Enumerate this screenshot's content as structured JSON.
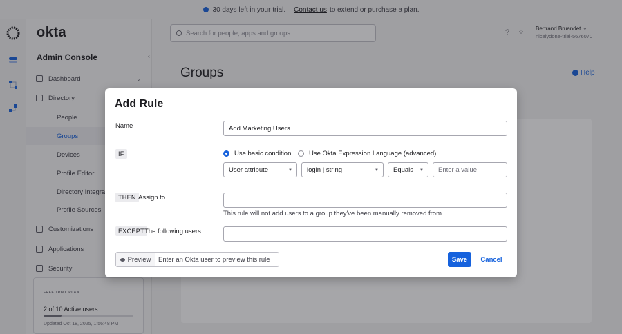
{
  "banner": {
    "text": "30 days left in your trial.",
    "link": "Contact us",
    "suffix": "to extend or purchase a plan."
  },
  "brand": {
    "logo": "okta",
    "accent": "#1662dd"
  },
  "header": {
    "search_placeholder": "Search for people, apps and groups",
    "user_name": "Bertrand Bruandet",
    "user_org": "nicelydone-trial-5676070"
  },
  "sidebar": {
    "title": "Admin Console",
    "items": [
      {
        "label": "Dashboard",
        "icon": "home-icon"
      },
      {
        "label": "Directory",
        "icon": "directory-icon"
      },
      {
        "label": "Customizations",
        "icon": "brush-icon"
      },
      {
        "label": "Applications",
        "icon": "grid-icon"
      },
      {
        "label": "Security",
        "icon": "shield-icon"
      }
    ],
    "subitems": [
      {
        "label": "People"
      },
      {
        "label": "Groups",
        "active": true
      },
      {
        "label": "Devices"
      },
      {
        "label": "Profile Editor"
      },
      {
        "label": "Directory Integrat"
      },
      {
        "label": "Profile Sources"
      }
    ],
    "trial": {
      "tag": "FREE TRIAL PLAN",
      "users": "2 of 10 Active users",
      "usage_fraction": 0.2,
      "updated": "Updated Oct 18, 2025, 1:56:48 PM"
    }
  },
  "page": {
    "title": "Groups",
    "help": "Help"
  },
  "modal": {
    "title": "Add Rule",
    "name_label": "Name",
    "name_value": "Add Marketing Users",
    "if_tag": "IF",
    "radio_basic": "Use basic condition",
    "radio_advanced": "Use Okta Expression Language (advanced)",
    "attr_select": "User attribute",
    "field_select": "login | string",
    "op_select": "Equals",
    "value_placeholder": "Enter a value",
    "then_tag": "THEN",
    "assign_label": "Assign to",
    "assign_hint": "This rule will not add users to a group they've been manually removed from.",
    "except_tag": "EXCEPT",
    "except_label": "The following users",
    "preview_label": "Preview",
    "preview_placeholder": "Enter an Okta user to preview this rule",
    "save": "Save",
    "cancel": "Cancel"
  }
}
